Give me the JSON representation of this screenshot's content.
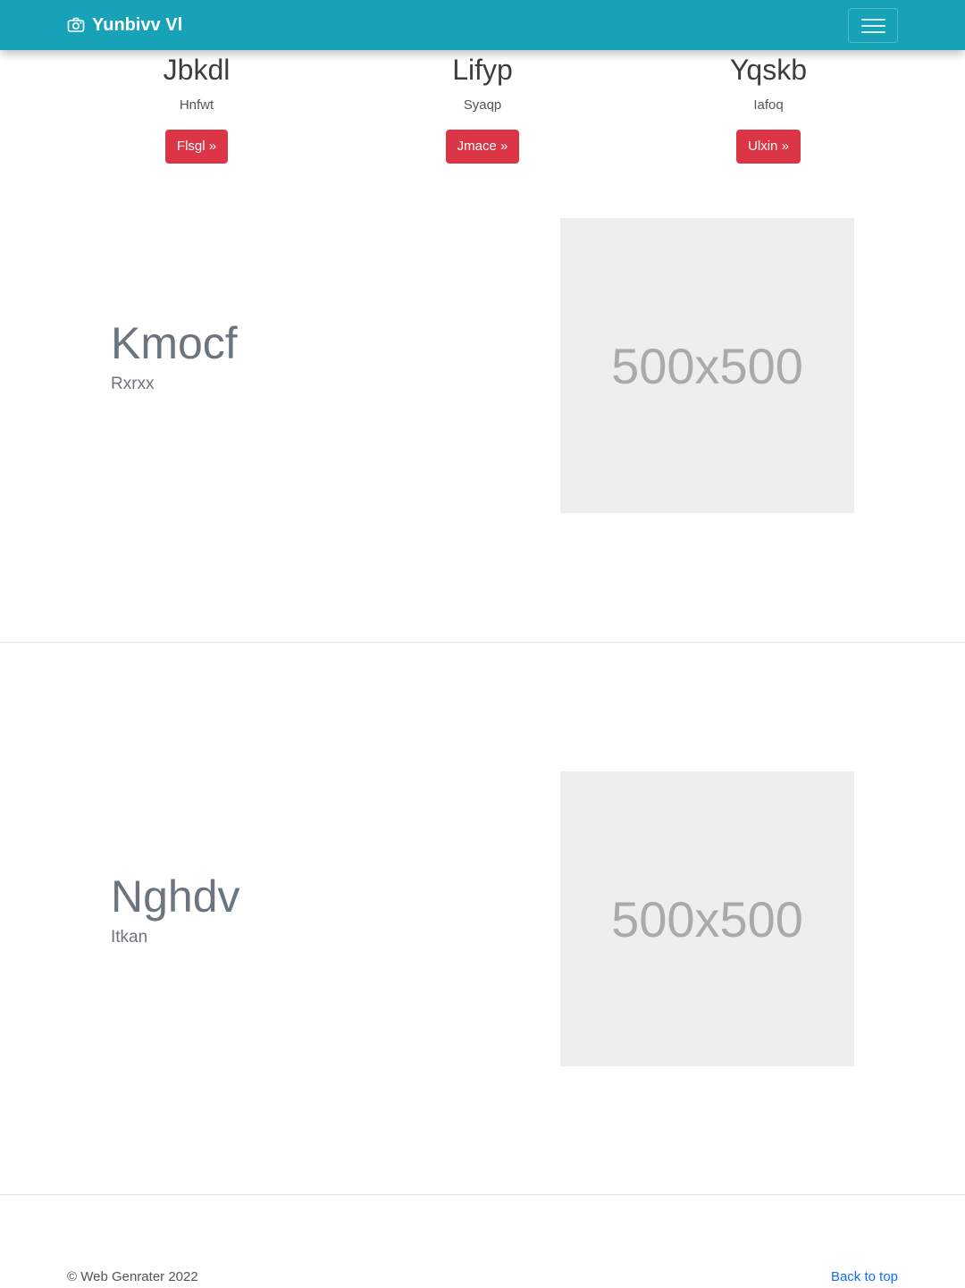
{
  "colors": {
    "navbar_bg": "#17a2b8",
    "button_bg": "#dc3545",
    "link": "#0d6efd"
  },
  "navbar": {
    "brand_icon": "camera-icon",
    "brand": "Yunbivv Vl",
    "toggler_icon": "hamburger-icon"
  },
  "features": [
    {
      "title": "Jbkdl",
      "text": "Hnfwt",
      "button": "Flsgl »"
    },
    {
      "title": "Lifyp",
      "text": "Syaqp",
      "button": "Jmace »"
    },
    {
      "title": "Yqskb",
      "text": "Iafoq",
      "button": "Ulxin »"
    }
  ],
  "featurettes": [
    {
      "heading": "Kmocf",
      "lead": "Rxrxx",
      "image_label": "500x500"
    },
    {
      "heading": "Nghdv",
      "lead": "Itkan",
      "image_label": "500x500"
    }
  ],
  "footer": {
    "copyright": "© Web Genrater 2022",
    "back_to_top": "Back to top"
  }
}
